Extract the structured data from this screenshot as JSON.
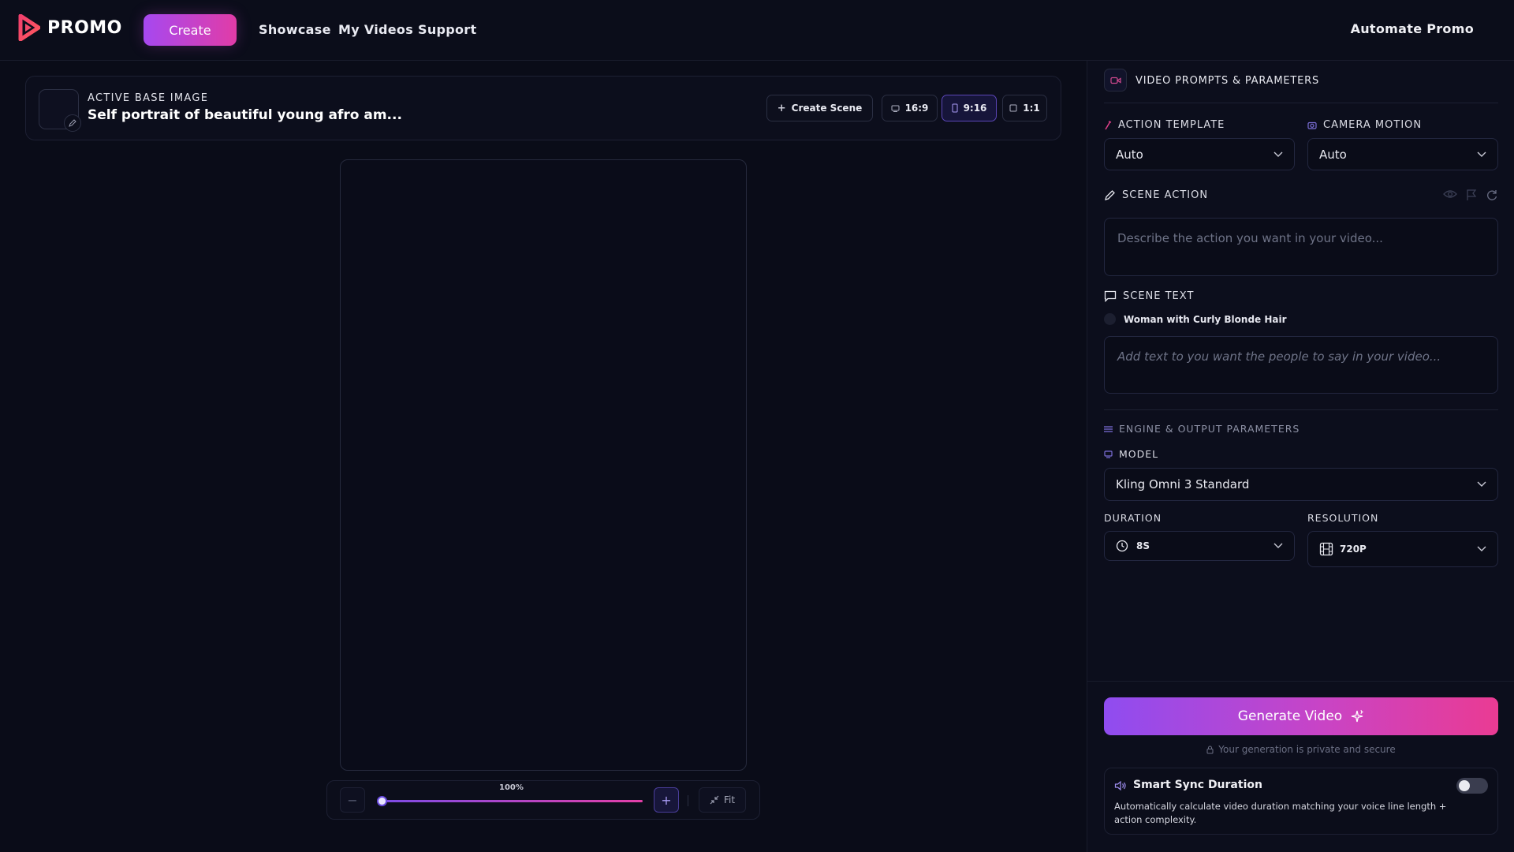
{
  "brand": {
    "name": "PROMO"
  },
  "nav": {
    "create": "Create",
    "links": [
      "Showcase",
      "My Videos",
      "Support"
    ],
    "automate": "Automate Promo"
  },
  "base_image": {
    "label": "ACTIVE BASE IMAGE",
    "title": "Self portrait of beautiful young afro am..."
  },
  "scene_controls": {
    "create_scene": "Create Scene",
    "ratios": [
      "16:9",
      "9:16",
      "1:1"
    ],
    "active_ratio": "9:16"
  },
  "zoom": {
    "level": "100%",
    "fit": "Fit",
    "minus": "−",
    "plus": "+"
  },
  "panel": {
    "header": "VIDEO PROMPTS & PARAMETERS",
    "action_template": {
      "label": "ACTION TEMPLATE",
      "value": "Auto"
    },
    "camera_motion": {
      "label": "CAMERA MOTION",
      "value": "Auto"
    },
    "scene_action": {
      "label": "SCENE ACTION",
      "placeholder": "Describe the action you want in your video..."
    },
    "scene_text": {
      "label": "SCENE TEXT",
      "speaker": "Woman with Curly Blonde Hair",
      "placeholder": "Add text to you want the people to say in your video..."
    },
    "engine": {
      "label": "ENGINE & OUTPUT PARAMETERS"
    },
    "model": {
      "label": "MODEL",
      "value": "Kling Omni 3 Standard"
    },
    "duration": {
      "label": "DURATION",
      "value": "8S"
    },
    "resolution": {
      "label": "RESOLUTION",
      "value": "720P"
    },
    "generate": "Generate Video",
    "privacy": "Your generation is private and secure",
    "smart_sync": {
      "title": "Smart Sync Duration",
      "description": "Automatically calculate video duration matching your voice line length + action complexity.",
      "enabled": false
    }
  },
  "colors": {
    "accent_start": "#a648f0",
    "accent_end": "#e13ca7",
    "background": "#0a0c18"
  }
}
